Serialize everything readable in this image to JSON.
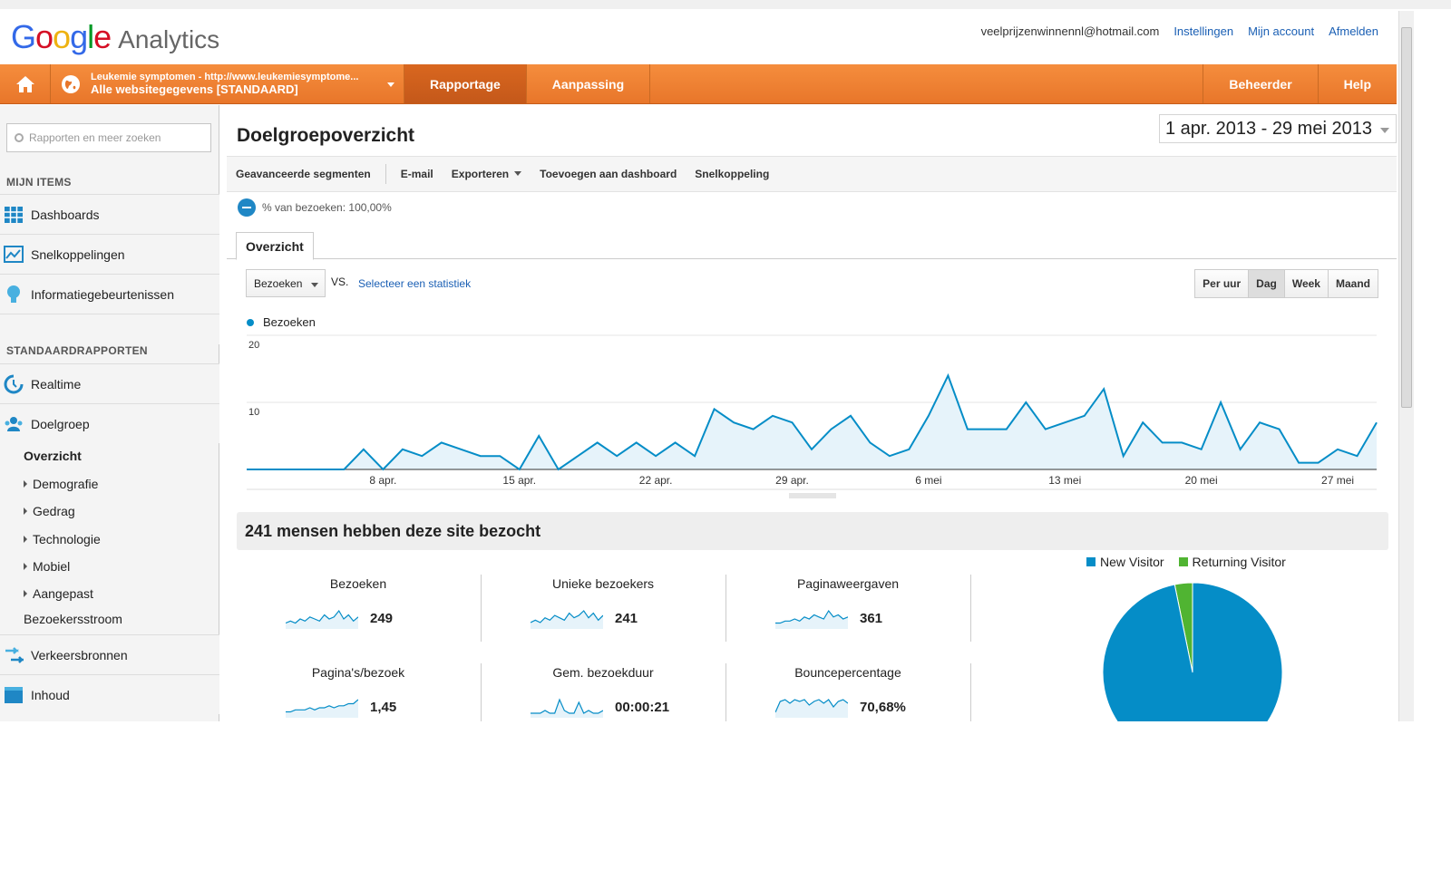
{
  "header": {
    "brand": "Google",
    "product": "Analytics",
    "email": "veelprijzenwinnennl@hotmail.com",
    "links": [
      "Instellingen",
      "Mijn account",
      "Afmelden"
    ]
  },
  "nav": {
    "site_line1": "Leukemie symptomen - http://www.leukemiesymptome...",
    "site_line2": "Alle websitegegevens [STANDAARD]",
    "tabs": [
      "Rapportage",
      "Aanpassing"
    ],
    "right_tabs": [
      "Beheerder",
      "Help"
    ]
  },
  "sidebar": {
    "search_placeholder": "Rapporten en meer zoeken",
    "section_mine": "MIJN ITEMS",
    "mine_items": [
      "Dashboards",
      "Snelkoppelingen",
      "Informatiegebeurtenissen"
    ],
    "section_standard": "STANDAARDRAPPORTEN",
    "standard_items": [
      "Realtime",
      "Doelgroep"
    ],
    "doelgroep_sub": [
      "Overzicht",
      "Demografie",
      "Gedrag",
      "Technologie",
      "Mobiel",
      "Aangepast",
      "Bezoekersstroom"
    ],
    "bottom_items": [
      "Verkeersbronnen",
      "Inhoud"
    ]
  },
  "main": {
    "title": "Doelgroepoverzicht",
    "date_range": "1 apr. 2013 - 29 mei 2013",
    "toolbar": [
      "Geavanceerde segmenten",
      "E-mail",
      "Exporteren",
      "Toevoegen aan dashboard",
      "Snelkoppeling"
    ],
    "segment": "% van bezoeken: 100,00%",
    "tab": "Overzicht",
    "metric_select": "Bezoeken",
    "vs": "VS.",
    "select_stat": "Selecteer een statistiek",
    "granularity": [
      "Per uur",
      "Dag",
      "Week",
      "Maand"
    ],
    "granularity_selected": "Dag",
    "summary": "241 mensen hebben deze site bezocht",
    "metrics": [
      {
        "name": "Bezoeken",
        "value": "249"
      },
      {
        "name": "Unieke bezoekers",
        "value": "241"
      },
      {
        "name": "Paginaweergaven",
        "value": "361"
      },
      {
        "name": "Pagina's/bezoek",
        "value": "1,45"
      },
      {
        "name": "Gem. bezoekduur",
        "value": "00:00:21"
      },
      {
        "name": "Bouncepercentage",
        "value": "70,68%"
      }
    ]
  },
  "colors": {
    "accent": "#e8762a",
    "line": "#058dc7",
    "new_visitor": "#058dc7",
    "returning_visitor": "#50b432"
  },
  "chart_data": [
    {
      "type": "area",
      "series": [
        {
          "name": "Bezoeken",
          "values": [
            0,
            0,
            0,
            0,
            0,
            0,
            3,
            0,
            3,
            2,
            4,
            3,
            2,
            2,
            0,
            5,
            0,
            2,
            4,
            2,
            4,
            2,
            4,
            2,
            9,
            7,
            6,
            8,
            7,
            3,
            6,
            8,
            4,
            2,
            3,
            8,
            14,
            6,
            6,
            6,
            10,
            6,
            7,
            8,
            12,
            2,
            7,
            4,
            4,
            3,
            10,
            3,
            7,
            6,
            1,
            1,
            3,
            2,
            7
          ]
        }
      ],
      "x_tick_labels": [
        "8 apr.",
        "15 apr.",
        "22 apr.",
        "29 apr.",
        "6 mei",
        "13 mei",
        "20 mei",
        "27 mei"
      ],
      "y_ticks": [
        10,
        20
      ],
      "ylim": [
        0,
        20
      ]
    },
    {
      "type": "pie",
      "categories": [
        "New Visitor",
        "Returning Visitor"
      ],
      "values": [
        96.8,
        3.2
      ]
    }
  ]
}
